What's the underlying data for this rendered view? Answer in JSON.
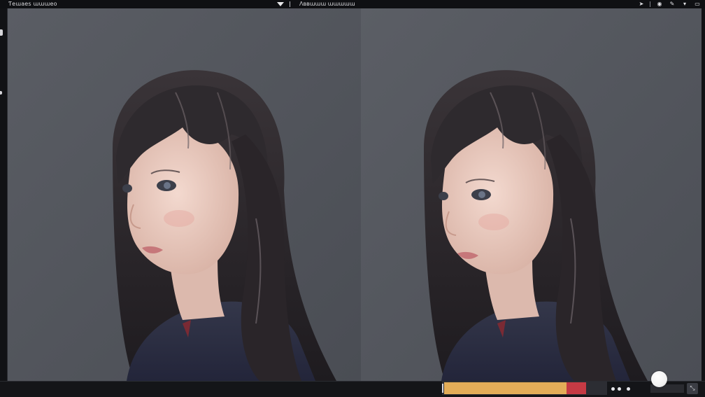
{
  "topbar": {
    "left_title": "Ƭeɯaes ɯɯɯeo",
    "center_label": "Ʌʙʙɯɯɯ ɯɯɯɯɯ",
    "icons": [
      "send-icon",
      "shield-icon",
      "edit-icon",
      "dropdown-icon",
      "window-icon"
    ]
  },
  "canvas": {
    "background": "#55585f",
    "panels": [
      "left-portrait",
      "right-portrait"
    ]
  },
  "timeline": {
    "fill_color": "#e3ad58",
    "marker_color": "#c53a44",
    "progress": 0.87,
    "marker_width_fraction": 0.12
  },
  "slider": {
    "value": 0.05
  },
  "bottombar": {
    "dots": 3,
    "right_icon": "resize-icon"
  }
}
